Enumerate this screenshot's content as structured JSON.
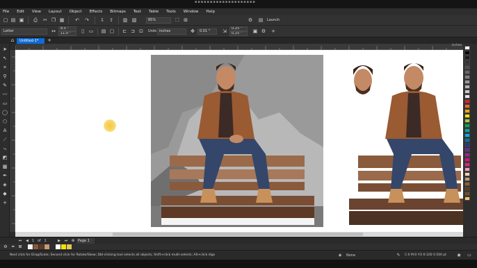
{
  "menubar": {
    "items": [
      "File",
      "Edit",
      "View",
      "Layout",
      "Object",
      "Effects",
      "Bitmaps",
      "Text",
      "Table",
      "Tools",
      "Window",
      "Help"
    ]
  },
  "toolbar1": {
    "zoom_value": "85%",
    "launch_label": "Launch",
    "icons": [
      "new-icon",
      "open-icon",
      "save-icon",
      "print-icon",
      "cut-icon",
      "copy-icon",
      "paste-icon",
      "undo-icon",
      "redo-icon",
      "import-icon",
      "export-icon",
      "full-screen-icon",
      "gear-icon"
    ]
  },
  "toolbar2": {
    "page_size": "Letter",
    "width": "8.5 \"",
    "height": "11.0 \"",
    "units_label": "Units:",
    "units_value": "inches",
    "nudge": "0.01 \"",
    "dup_x": "0.25 \"",
    "dup_y": "0.25 \""
  },
  "document_tab": {
    "label": "Untitled-1*"
  },
  "ruler": {
    "units_label": "inches"
  },
  "pagebar": {
    "page_counter": "1   of   1",
    "page_tab": "Page 1"
  },
  "statusbar": {
    "hint": "Next click for Drag/Scale; Second click for Rotate/Skew; Dbl-clicking tool selects all objects; Shift+click multi-selects; Alt+click digs",
    "fill_label": "None",
    "color_info": "C:0 M:0 Y:0 K:100  0.500 pt"
  },
  "palette_colors": [
    "#ffffff",
    "#000000",
    "#1a1a1a",
    "#333333",
    "#4d4d4d",
    "#666666",
    "#808080",
    "#999999",
    "#b3b3b3",
    "#cccccc",
    "#e6e6e6",
    "#e31d2c",
    "#f26a21",
    "#f7a21b",
    "#ffe600",
    "#a6ce39",
    "#00a651",
    "#00a99d",
    "#00aeef",
    "#0072bc",
    "#2e3192",
    "#662d91",
    "#92278f",
    "#ec008c",
    "#ed1c7b",
    "#f49ac1",
    "#fbd2b4",
    "#c69c6d",
    "#8c6239",
    "#603913",
    "#754c24",
    "#f6c36b"
  ],
  "doc_palette_colors": [
    "#f2f2f2",
    "#8a5a3c",
    "#5a3a28",
    "#c89a72",
    "#2d2d2d",
    "#ffffff",
    "#f4e300",
    "#e0c85a"
  ]
}
